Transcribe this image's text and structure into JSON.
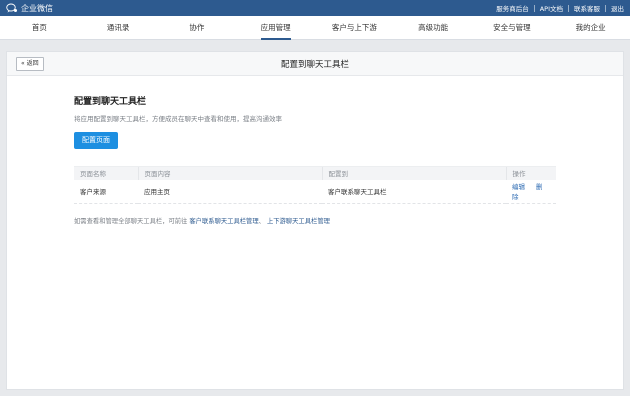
{
  "topbar": {
    "brand": "企业微信",
    "links": [
      "服务商后台",
      "API文档",
      "联系客服",
      "退出"
    ]
  },
  "nav": {
    "items": [
      "首页",
      "通讯录",
      "协作",
      "应用管理",
      "客户与上下游",
      "高级功能",
      "安全与管理",
      "我的企业"
    ],
    "active_index": 3
  },
  "card": {
    "back_label": "« 返回",
    "title": "配置到聊天工具栏"
  },
  "section": {
    "title": "配置到聊天工具栏",
    "desc": "将应用配置到聊天工具栏，方便成员在聊天中查看和使用，提高沟通效率",
    "button": "配置页面"
  },
  "table": {
    "headers": [
      "页面名称",
      "页面内容",
      "配置到",
      "操作"
    ],
    "rows": [
      {
        "name": "客户来源",
        "content": "应用主页",
        "target": "客户联系聊天工具栏",
        "edit": "编辑",
        "delete": "删除"
      }
    ]
  },
  "footer": {
    "prefix": "如需查看和管理全部聊天工具栏，可前往",
    "link1": "客户联系聊天工具栏管理",
    "sep": "、",
    "link2": "上下游聊天工具栏管理"
  },
  "colors": {
    "topbar": "#2d5a8f",
    "primary": "#1d8fe1",
    "link": "#2d6bb3"
  }
}
